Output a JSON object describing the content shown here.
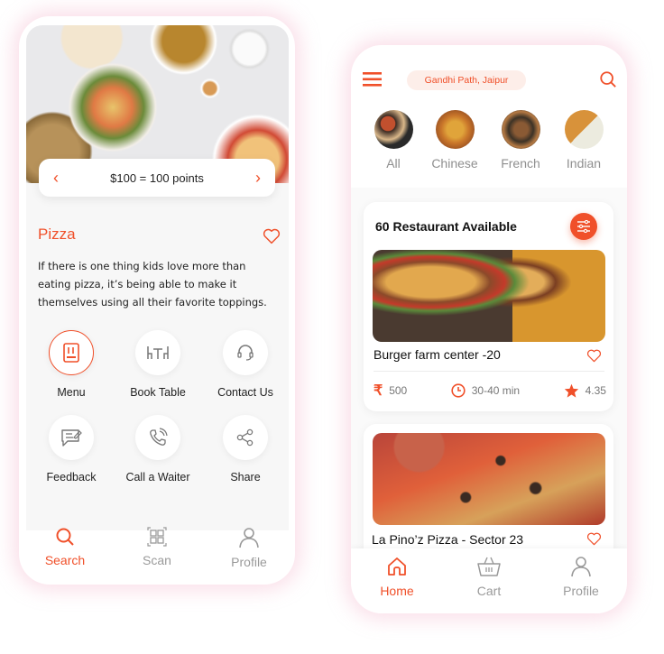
{
  "left_screen": {
    "points_banner": {
      "text": "$100 = 100 points",
      "prev_icon": "chevron-left-icon",
      "next_icon": "chevron-right-icon"
    },
    "title": "Pizza",
    "description": "If there is one thing kids love more than eating pizza, it’s being able to make it themselves using all their favorite toppings.",
    "actions": [
      {
        "label": "Menu",
        "icon": "menu-book-icon",
        "active": true
      },
      {
        "label": "Book Table",
        "icon": "table-icon",
        "active": false
      },
      {
        "label": "Contact Us",
        "icon": "headset-icon",
        "active": false
      },
      {
        "label": "Feedback",
        "icon": "feedback-icon",
        "active": false
      },
      {
        "label": "Call a Waiter",
        "icon": "phone-call-icon",
        "active": false
      },
      {
        "label": "Share",
        "icon": "share-icon",
        "active": false
      }
    ],
    "bottom_nav": [
      {
        "label": "Search",
        "icon": "search-icon",
        "active": true
      },
      {
        "label": "Scan",
        "icon": "qr-scan-icon",
        "active": false
      },
      {
        "label": "Profile",
        "icon": "user-icon",
        "active": false
      }
    ]
  },
  "right_screen": {
    "location": "Gandhi Path, Jaipur",
    "categories": [
      {
        "label": "All"
      },
      {
        "label": "Chinese"
      },
      {
        "label": "French"
      },
      {
        "label": "Indian"
      }
    ],
    "list_header": "60 Restaurant Available",
    "restaurants": [
      {
        "name": "Burger farm center -20",
        "price": "500",
        "time": "30-40 min",
        "rating": "4.35"
      },
      {
        "name": "La Pino’z Pizza - Sector 23"
      }
    ],
    "bottom_nav": [
      {
        "label": "Home",
        "icon": "home-icon",
        "active": true
      },
      {
        "label": "Cart",
        "icon": "basket-icon",
        "active": false
      },
      {
        "label": "Profile",
        "icon": "user-icon",
        "active": false
      }
    ]
  },
  "colors": {
    "accent": "#f0502a",
    "muted": "#9a9a9a"
  }
}
